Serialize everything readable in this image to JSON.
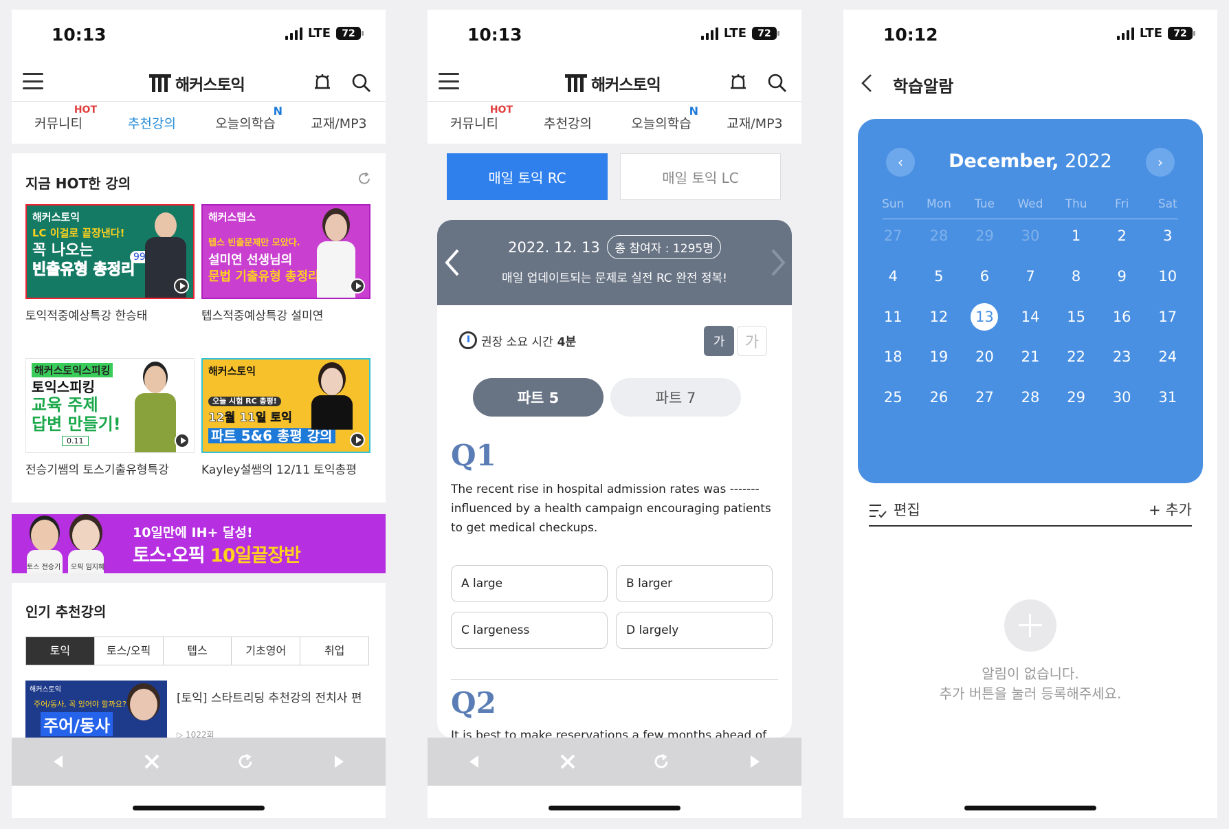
{
  "status": {
    "time1": "10:13",
    "time2": "10:13",
    "time3": "10:12",
    "network": "LTE",
    "battery": "72"
  },
  "app": {
    "name": "해커스토익"
  },
  "tabs": [
    {
      "label": "커뮤니티",
      "badge": "HOT"
    },
    {
      "label": "추천강의"
    },
    {
      "label": "오늘의학습",
      "badge": "N"
    },
    {
      "label": "교재/MP3"
    }
  ],
  "screen1": {
    "hot_title": "지금 HOT한 강의",
    "videos": [
      {
        "brand": "해커스토익",
        "line1": "LC 이걸로 끝장낸다!",
        "line2": "꼭 나오는",
        "line3": "빈출유형 총정리",
        "score": "990",
        "caption": "토익적중예상특강 한승태"
      },
      {
        "brand": "해커스텝스",
        "line1": "텝스 빈출문제만 모았다.",
        "line2": "설미연 선생님의",
        "line3": "문법 기출유형 총정리!",
        "caption": "텝스적중예상특강 설미연"
      },
      {
        "brand": "해커스토익스피킹",
        "line1": "토익스피킹",
        "line2": "교육 주제",
        "line3": "답변 만들기!",
        "tag": "0.11",
        "caption": "전승기쌤의 토스기출유형특강"
      },
      {
        "brand": "해커스토익",
        "line1": "오늘 시험 RC 총평!",
        "line2": "12월 11일 토익",
        "line3": "파트 5&6 총평 강의",
        "caption": "Kayley설쌤의 12/11 토익총평"
      }
    ],
    "banner": {
      "line1": "10일만에 IH+ 달성!",
      "line2a": "토스·오픽 ",
      "line2b": "10일끝장반",
      "name1": "토스 전승기",
      "name2": "오픽 임지혜"
    },
    "popular_title": "인기 추천강의",
    "categories": [
      "토익",
      "토스/오픽",
      "텝스",
      "기초영어",
      "취업"
    ],
    "lecture": {
      "brand": "해커스토익",
      "thumb_line1": "주어/동사, 꼭 있어야 할까요?",
      "thumb_line2": "주어/동사",
      "title": "[토익] 스타트리딩 추천강의 전치사 편",
      "meta": "▷ 1022회"
    }
  },
  "screen2": {
    "seg_rc": "매일 토익 RC",
    "seg_lc": "매일 토익 LC",
    "date": "2022. 12. 13",
    "participants": "총 참여자 : 1295명",
    "subtitle": "매일 업데이트되는 문제로 실전 RC 완전 정복!",
    "time_label": "권장 소요 시간",
    "time_value": "4분",
    "font_small": "가",
    "font_big": "가",
    "part5": "파트 5",
    "part7": "파트 7",
    "q1": "Q1",
    "q1_text": "The recent rise in hospital admission rates was ------- influenced by a health campaign encouraging patients to get medical checkups.",
    "choices": [
      "A large",
      "B larger",
      "C largeness",
      "D largely"
    ],
    "q2": "Q2",
    "q2_text": "It is best to make reservations a few months ahead of"
  },
  "screen3": {
    "title": "학습알람",
    "month": "December,",
    "year": "2022",
    "weekdays": [
      "Sun",
      "Mon",
      "Tue",
      "Wed",
      "Thu",
      "Fri",
      "Sat"
    ],
    "weeks": [
      [
        "27",
        "28",
        "29",
        "30",
        "1",
        "2",
        "3"
      ],
      [
        "4",
        "5",
        "6",
        "7",
        "8",
        "9",
        "10"
      ],
      [
        "11",
        "12",
        "13",
        "14",
        "15",
        "16",
        "17"
      ],
      [
        "18",
        "19",
        "20",
        "21",
        "22",
        "23",
        "24"
      ],
      [
        "25",
        "26",
        "27",
        "28",
        "29",
        "30",
        "31"
      ]
    ],
    "today": "13",
    "prev": "‹",
    "next": "›",
    "edit": "편집",
    "add": "+ 추가",
    "empty_line1": "알림이 없습니다.",
    "empty_line2": "추가 버튼을 눌러 등록해주세요."
  },
  "colors": {
    "accent_blue": "#2f80ed",
    "calendar_blue": "#4a90e2",
    "slate": "#687384",
    "hot_red": "#e23d3d",
    "banner_purple": "#b62fe0"
  },
  "icons": [
    "menu-icon",
    "bell-icon",
    "search-icon",
    "refresh-icon",
    "play-icon",
    "back-icon",
    "forward-icon",
    "close-icon",
    "reload-icon",
    "clock-icon",
    "edit-list-icon",
    "plus-icon"
  ]
}
